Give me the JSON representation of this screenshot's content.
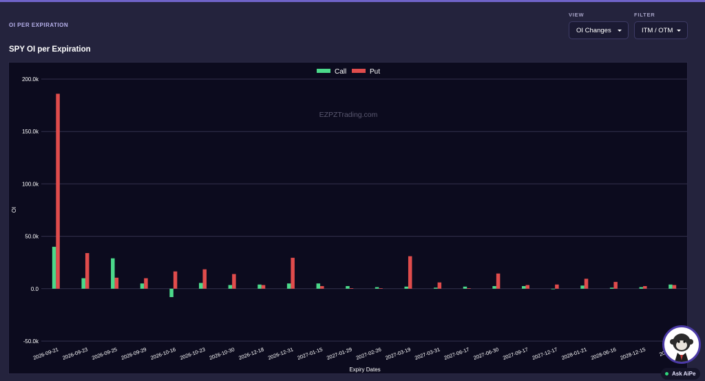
{
  "section": {
    "title": "OI PER EXPIRATION"
  },
  "chart_title": "SPY OI per Expiration",
  "controls": {
    "view": {
      "label": "VIEW",
      "value": "OI Changes"
    },
    "filter": {
      "label": "FILTER",
      "value": "ITM / OTM"
    }
  },
  "watermark": "EZPZTrading.com",
  "ask": {
    "label": "Ask AiPe"
  },
  "colors": {
    "call": "#4bd98a",
    "put": "#e04c4c",
    "accent": "#6f63c8"
  },
  "chart_data": {
    "type": "bar",
    "xlabel": "Expiry Dates",
    "ylabel": "OI",
    "ylim": [
      -50000,
      200000
    ],
    "yticks": [
      -50000,
      0,
      50000,
      100000,
      150000,
      200000
    ],
    "ytick_labels": [
      "-50.0k",
      "0.0",
      "50.0k",
      "100.0k",
      "150.0k",
      "200.0k"
    ],
    "legend": "top-center",
    "grid": true,
    "categories": [
      "2026-09-21",
      "2026-09-23",
      "2026-09-25",
      "2026-09-29",
      "2026-10-16",
      "2026-10-23",
      "2026-10-30",
      "2026-12-18",
      "2026-12-31",
      "2027-01-15",
      "2027-01-29",
      "2027-02-26",
      "2027-03-19",
      "2027-03-31",
      "2027-06-17",
      "2027-06-30",
      "2027-09-17",
      "2027-12-17",
      "2028-01-21",
      "2028-06-16",
      "2028-12-15",
      "2029-0"
    ],
    "series": [
      {
        "name": "Call",
        "values": [
          40000,
          10000,
          29000,
          5000,
          -8000,
          5500,
          3500,
          4000,
          5000,
          5000,
          2500,
          1500,
          2000,
          1000,
          2000,
          2500,
          2500,
          -500,
          3000,
          1000,
          1500,
          4000
        ]
      },
      {
        "name": "Put",
        "values": [
          186000,
          34000,
          10500,
          10000,
          16500,
          18500,
          14000,
          3500,
          29500,
          2500,
          500,
          500,
          31000,
          6000,
          500,
          14500,
          3500,
          4000,
          9500,
          6500,
          2500,
          3500
        ]
      }
    ]
  }
}
